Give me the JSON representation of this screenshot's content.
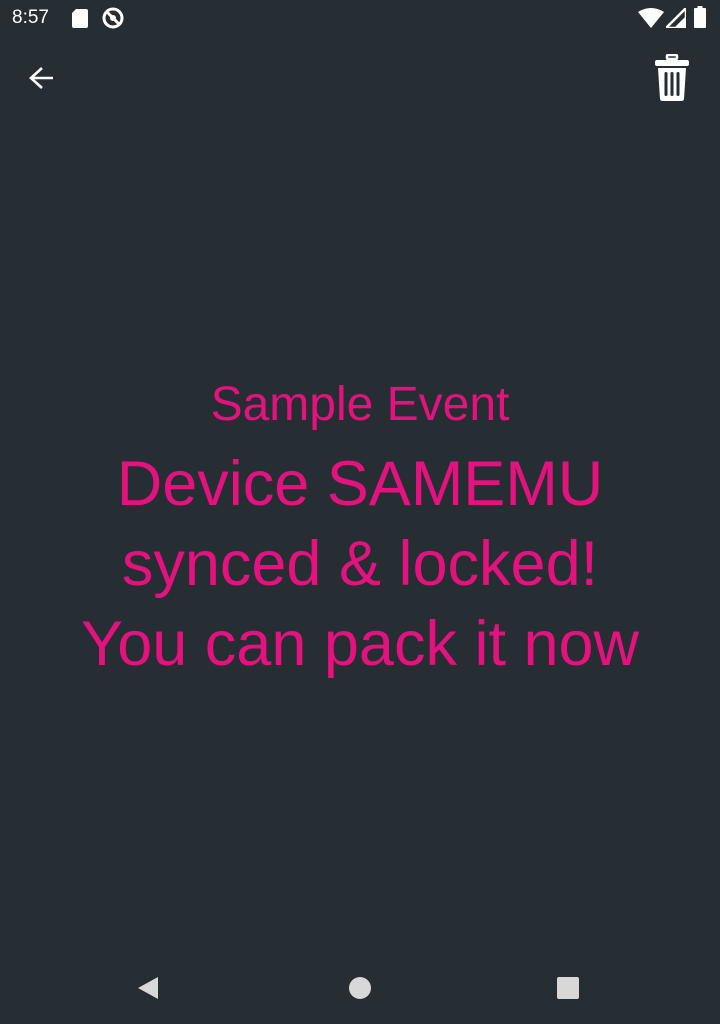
{
  "status_bar": {
    "time": "8:57",
    "icons": [
      "sd-card-icon",
      "sync-icon",
      "wifi-icon",
      "cell-signal-icon",
      "battery-icon"
    ]
  },
  "toolbar": {
    "back_icon": "arrow-left-icon",
    "delete_icon": "trash-icon"
  },
  "content": {
    "event_name": "Sample Event",
    "message_lines": [
      "Device SAMEMU",
      "synced & locked!",
      "You can pack it now"
    ]
  },
  "nav_bar": {
    "icons": [
      "nav-back-icon",
      "nav-home-icon",
      "nav-recents-icon"
    ]
  },
  "colors": {
    "background": "#262d33",
    "accent": "#e3127f",
    "icon": "#ffffff"
  }
}
